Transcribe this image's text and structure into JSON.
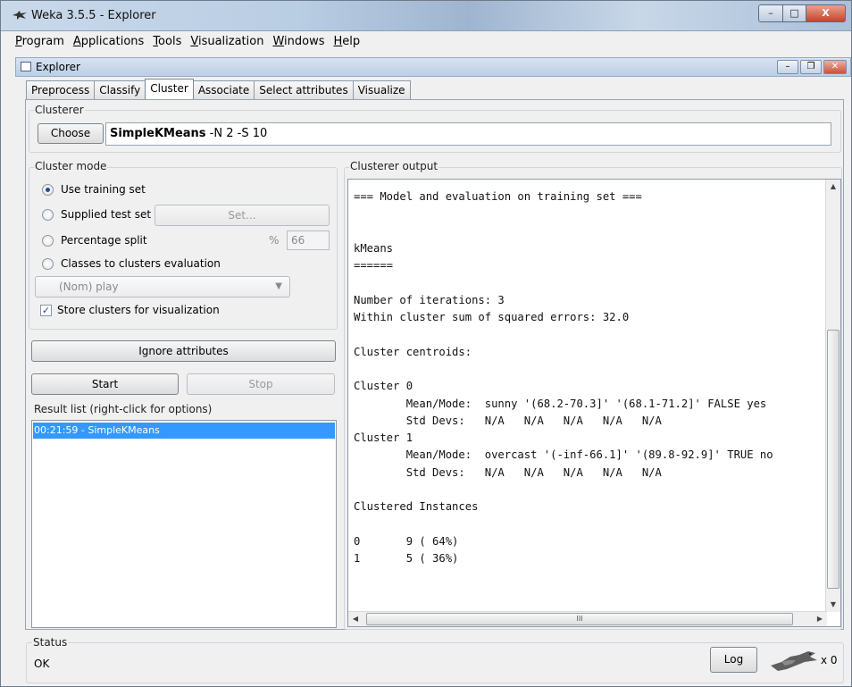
{
  "window": {
    "title": "Weka 3.5.5 - Explorer",
    "minimize": "–",
    "maximize": "□",
    "close": "X"
  },
  "menu": [
    {
      "label": "Program",
      "accel": "P",
      "rest": "rogram"
    },
    {
      "label": "Applications",
      "accel": "A",
      "rest": "pplications"
    },
    {
      "label": "Tools",
      "accel": "T",
      "rest": "ools"
    },
    {
      "label": "Visualization",
      "accel": "V",
      "rest": "isualization"
    },
    {
      "label": "Windows",
      "accel": "W",
      "rest": "indows"
    },
    {
      "label": "Help",
      "accel": "H",
      "rest": "elp"
    }
  ],
  "inner_window": {
    "title": "Explorer"
  },
  "tabs": [
    "Preprocess",
    "Classify",
    "Cluster",
    "Associate",
    "Select attributes",
    "Visualize"
  ],
  "active_tab": "Cluster",
  "clusterer": {
    "group_label": "Clusterer",
    "choose_label": "Choose",
    "name": "SimpleKMeans",
    "options": " -N 2 -S 10"
  },
  "cluster_mode": {
    "group_label": "Cluster mode",
    "use_training": "Use training set",
    "supplied_test": "Supplied test set",
    "set_label": "Set...",
    "percentage_split": "Percentage split",
    "percent_symbol": "%",
    "percent_value": "66",
    "classes_to_clusters": "Classes to clusters evaluation",
    "class_select": "(Nom) play",
    "store_clusters": "Store clusters for visualization",
    "selected": "use_training",
    "store_checked": true
  },
  "buttons": {
    "ignore_attributes": "Ignore attributes",
    "start": "Start",
    "stop": "Stop",
    "log": "Log"
  },
  "result_list": {
    "label": "Result list (right-click for options)",
    "items": [
      "00:21:59 - SimpleKMeans"
    ]
  },
  "output": {
    "label": "Clusterer output",
    "lines": [
      "=== Model and evaluation on training set ===",
      "",
      "",
      "kMeans",
      "======",
      "",
      "Number of iterations: 3",
      "Within cluster sum of squared errors: 32.0",
      "",
      "Cluster centroids:",
      "",
      "Cluster 0",
      "        Mean/Mode:  sunny '(68.2-70.3]' '(68.1-71.2]' FALSE yes",
      "        Std Devs:   N/A   N/A   N/A   N/A   N/A",
      "Cluster 1",
      "        Mean/Mode:  overcast '(-inf-66.1]' '(89.8-92.9]' TRUE no",
      "        Std Devs:   N/A   N/A   N/A   N/A   N/A",
      "",
      "Clustered Instances",
      "",
      "0       9 ( 64%)",
      "1       5 ( 36%)"
    ],
    "hscroll_grip": "III"
  },
  "status": {
    "label": "Status",
    "text": "OK",
    "task_count": "x 0"
  }
}
